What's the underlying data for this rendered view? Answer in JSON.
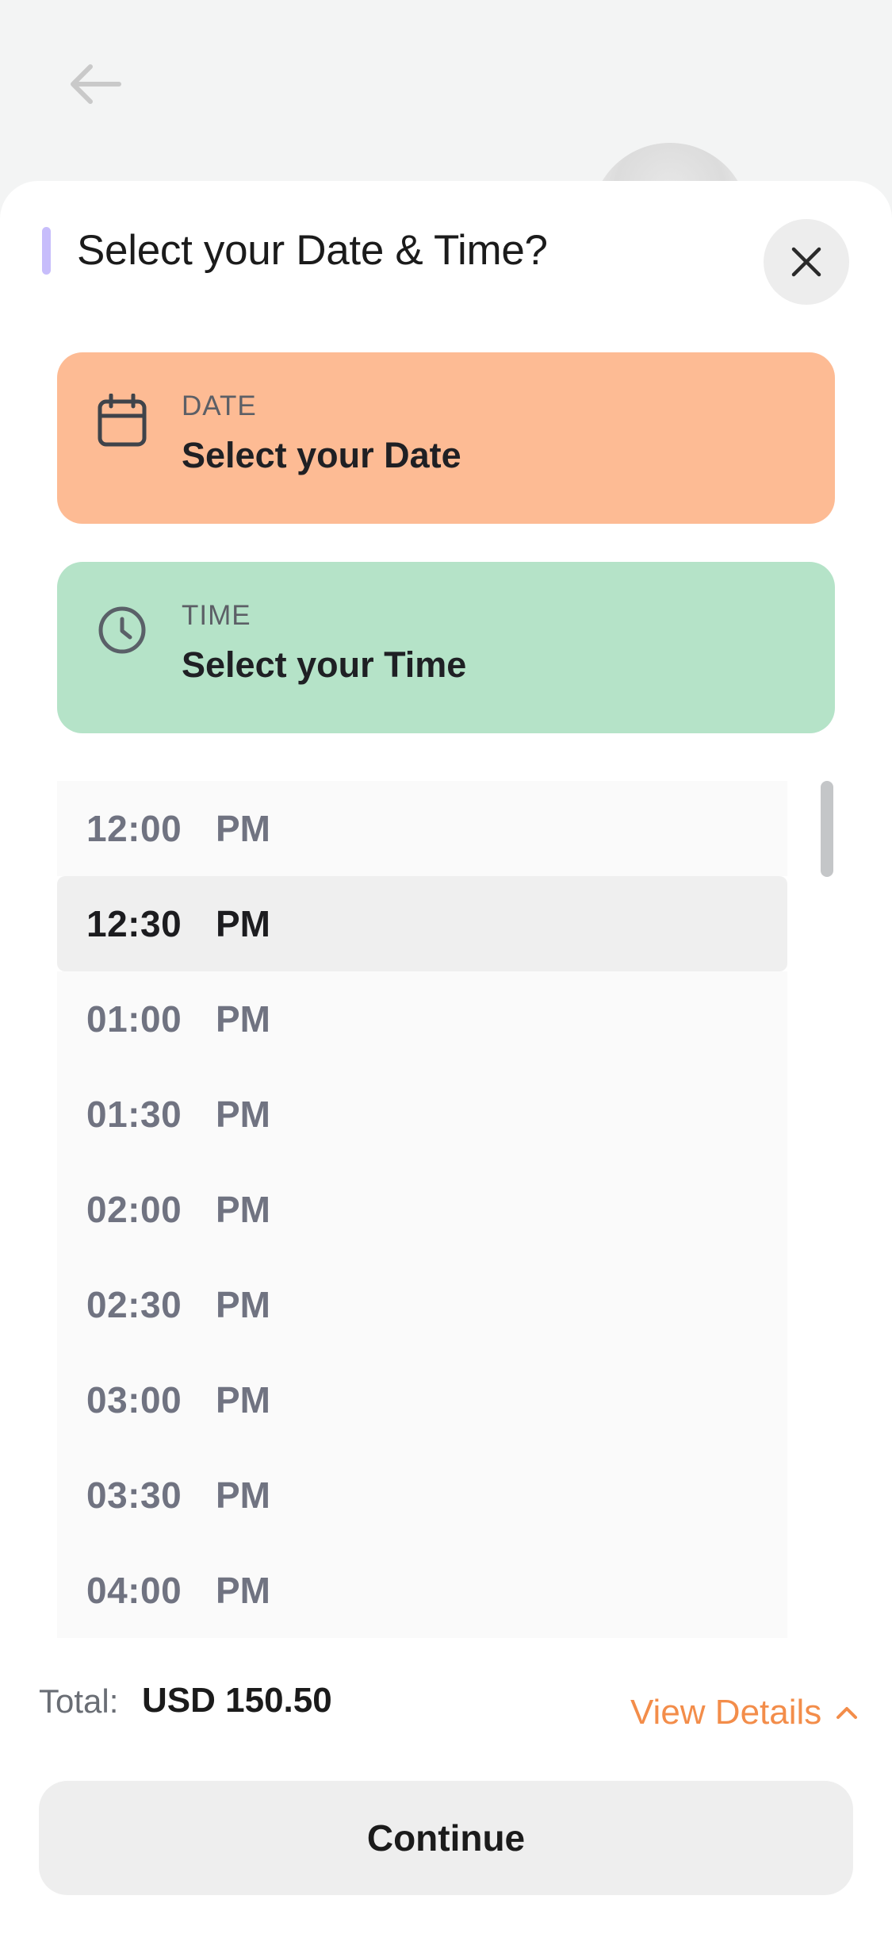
{
  "sheet": {
    "title": "Select your Date & Time?"
  },
  "date_card": {
    "label": "DATE",
    "value": "Select your Date"
  },
  "time_card": {
    "label": "TIME",
    "value": "Select your Time"
  },
  "time_slots": [
    {
      "time": "12:00",
      "period": "PM",
      "selected": false
    },
    {
      "time": "12:30",
      "period": "PM",
      "selected": true
    },
    {
      "time": "01:00",
      "period": "PM",
      "selected": false
    },
    {
      "time": "01:30",
      "period": "PM",
      "selected": false
    },
    {
      "time": "02:00",
      "period": "PM",
      "selected": false
    },
    {
      "time": "02:30",
      "period": "PM",
      "selected": false
    },
    {
      "time": "03:00",
      "period": "PM",
      "selected": false
    },
    {
      "time": "03:30",
      "period": "PM",
      "selected": false
    },
    {
      "time": "04:00",
      "period": "PM",
      "selected": false
    }
  ],
  "footer": {
    "total_label": "Total:",
    "total_value": "USD 150.50",
    "view_details": "View Details",
    "continue_label": "Continue"
  },
  "icons": {
    "back": "arrow-left-icon",
    "close": "close-icon",
    "calendar": "calendar-icon",
    "clock": "clock-icon",
    "chevron": "chevron-up-icon"
  },
  "colors": {
    "accent_purple": "#c7bdfb",
    "date_card_bg": "#fdbb94",
    "time_card_bg": "#b5e3c8",
    "link_orange": "#f38d4a"
  }
}
